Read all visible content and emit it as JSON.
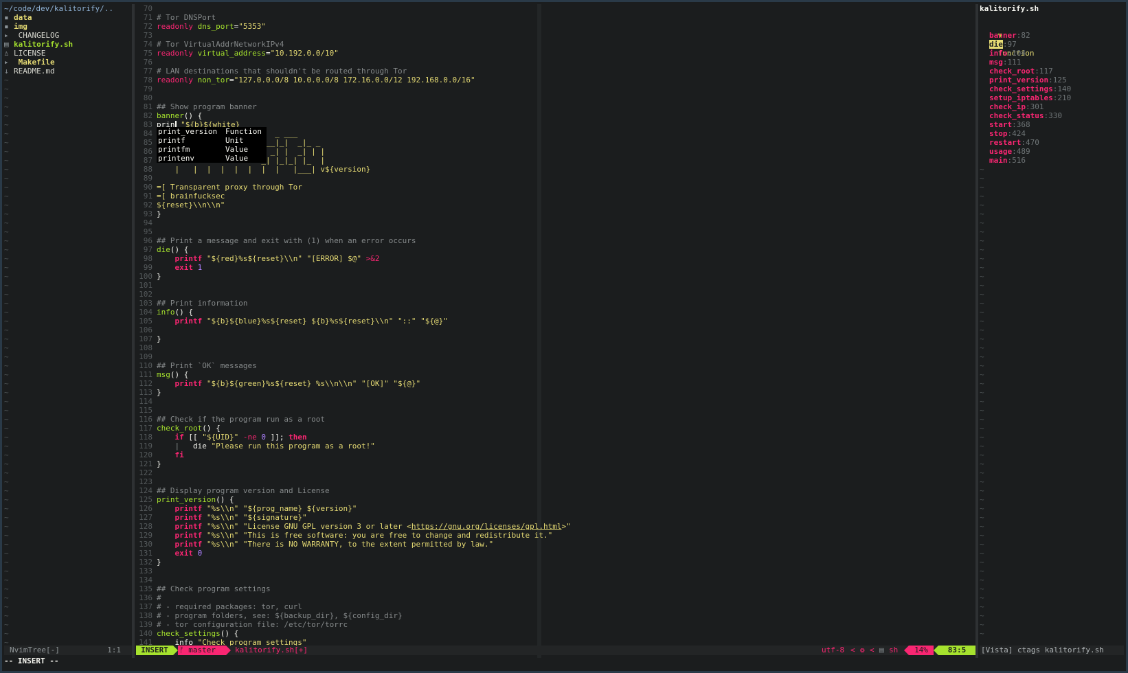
{
  "tree": {
    "root_path": "~/code/dev/kalitorify/..",
    "entries": [
      {
        "icon": "▪",
        "name": "data",
        "kind": "dir"
      },
      {
        "icon": "▪",
        "name": "img",
        "kind": "dir"
      },
      {
        "icon": "▸",
        "name": " CHANGELOG",
        "kind": "file"
      },
      {
        "icon": "▤",
        "name": "kalitorify.sh",
        "kind": "exe"
      },
      {
        "icon": "♙",
        "name": "LICENSE",
        "kind": "file"
      },
      {
        "icon": "▸",
        "name": " Makefile",
        "kind": "dir"
      },
      {
        "icon": "↓",
        "name": "README.md",
        "kind": "file"
      }
    ],
    "empty_marker": "~"
  },
  "editor": {
    "lines": [
      {
        "n": "70",
        "segs": []
      },
      {
        "n": "71",
        "segs": [
          [
            "c",
            "# Tor DNSPort"
          ]
        ]
      },
      {
        "n": "72",
        "segs": [
          [
            "kl",
            "readonly "
          ],
          [
            "f",
            "dns_port"
          ],
          [
            "w",
            "="
          ],
          [
            "s",
            "\"5353\""
          ]
        ]
      },
      {
        "n": "73",
        "segs": []
      },
      {
        "n": "74",
        "segs": [
          [
            "c",
            "# Tor VirtualAddrNetworkIPv4"
          ]
        ]
      },
      {
        "n": "75",
        "segs": [
          [
            "kl",
            "readonly "
          ],
          [
            "f",
            "virtual_address"
          ],
          [
            "w",
            "="
          ],
          [
            "s",
            "\"10.192.0.0/10\""
          ]
        ]
      },
      {
        "n": "76",
        "segs": []
      },
      {
        "n": "77",
        "segs": [
          [
            "c",
            "# LAN destinations that shouldn't be routed through Tor"
          ]
        ]
      },
      {
        "n": "78",
        "segs": [
          [
            "kl",
            "readonly "
          ],
          [
            "f",
            "non_tor"
          ],
          [
            "w",
            "="
          ],
          [
            "s",
            "\"127.0.0.0/8 10.0.0.0/8 172.16.0.0/12 192.168.0.0/16\""
          ]
        ]
      },
      {
        "n": "79",
        "segs": []
      },
      {
        "n": "80",
        "segs": []
      },
      {
        "n": "81",
        "segs": [
          [
            "c",
            "## Show program banner"
          ]
        ]
      },
      {
        "n": "82",
        "segs": [
          [
            "f",
            "banner"
          ],
          [
            "w",
            "() {"
          ]
        ]
      },
      {
        "n": "83",
        "segs": [
          [
            "w",
            "prin"
          ],
          [
            "cursor",
            ""
          ],
          [
            "w",
            " "
          ],
          [
            "s",
            "\"${b}${white}"
          ]
        ]
      },
      {
        "n": "84",
        "segs": [
          [
            "s",
            "                          _ ___"
          ]
        ]
      },
      {
        "n": "85",
        "segs": [
          [
            "s",
            "                       ___|_|  _|_ _"
          ]
        ]
      },
      {
        "n": "86",
        "segs": [
          [
            "s",
            "                         _| |  _| | |"
          ]
        ]
      },
      {
        "n": "87",
        "segs": [
          [
            "s",
            "                       _| |_|_| |_  |"
          ]
        ]
      },
      {
        "n": "88",
        "segs": [
          [
            "s",
            "    |   |  |  |  |  |  |  |   |___| v${version}"
          ]
        ]
      },
      {
        "n": "89",
        "segs": []
      },
      {
        "n": "90",
        "segs": [
          [
            "s",
            "=[ Transparent proxy through Tor"
          ]
        ]
      },
      {
        "n": "91",
        "segs": [
          [
            "s",
            "=[ brainfucksec"
          ]
        ]
      },
      {
        "n": "92",
        "segs": [
          [
            "s",
            "${reset}\\\\n\\\\n\""
          ]
        ]
      },
      {
        "n": "93",
        "segs": [
          [
            "w",
            "}"
          ]
        ]
      },
      {
        "n": "94",
        "segs": []
      },
      {
        "n": "95",
        "segs": []
      },
      {
        "n": "96",
        "segs": [
          [
            "c",
            "## Print a message and exit with (1) when an error occurs"
          ]
        ]
      },
      {
        "n": "97",
        "segs": [
          [
            "f",
            "die"
          ],
          [
            "w",
            "() {"
          ]
        ]
      },
      {
        "n": "98",
        "segs": [
          [
            "w",
            "    "
          ],
          [
            "k",
            "printf"
          ],
          [
            "w",
            " "
          ],
          [
            "s",
            "\"${red}%s${reset}\\\\n\""
          ],
          [
            "w",
            " "
          ],
          [
            "s",
            "\"[ERROR] $@\""
          ],
          [
            "w",
            " "
          ],
          [
            "kl",
            ">&2"
          ]
        ]
      },
      {
        "n": "99",
        "segs": [
          [
            "w",
            "    "
          ],
          [
            "k",
            "exit"
          ],
          [
            "w",
            " "
          ],
          [
            "n",
            "1"
          ]
        ]
      },
      {
        "n": "100",
        "segs": [
          [
            "w",
            "}"
          ]
        ]
      },
      {
        "n": "101",
        "segs": []
      },
      {
        "n": "102",
        "segs": []
      },
      {
        "n": "103",
        "segs": [
          [
            "c",
            "## Print information"
          ]
        ]
      },
      {
        "n": "104",
        "segs": [
          [
            "f",
            "info"
          ],
          [
            "w",
            "() {"
          ]
        ]
      },
      {
        "n": "105",
        "segs": [
          [
            "w",
            "    "
          ],
          [
            "k",
            "printf"
          ],
          [
            "w",
            " "
          ],
          [
            "s",
            "\"${b}${blue}%s${reset} ${b}%s${reset}\\\\n\""
          ],
          [
            "w",
            " "
          ],
          [
            "s",
            "\"::\""
          ],
          [
            "w",
            " "
          ],
          [
            "s",
            "\"${@}\""
          ]
        ]
      },
      {
        "n": "106",
        "segs": []
      },
      {
        "n": "107",
        "segs": [
          [
            "w",
            "}"
          ]
        ]
      },
      {
        "n": "108",
        "segs": []
      },
      {
        "n": "109",
        "segs": []
      },
      {
        "n": "110",
        "segs": [
          [
            "c",
            "## Print `OK` messages"
          ]
        ]
      },
      {
        "n": "111",
        "segs": [
          [
            "f",
            "msg"
          ],
          [
            "w",
            "() {"
          ]
        ]
      },
      {
        "n": "112",
        "segs": [
          [
            "w",
            "    "
          ],
          [
            "k",
            "printf"
          ],
          [
            "w",
            " "
          ],
          [
            "s",
            "\"${b}${green}%s${reset} %s\\\\n\\\\n\""
          ],
          [
            "w",
            " "
          ],
          [
            "s",
            "\"[OK]\""
          ],
          [
            "w",
            " "
          ],
          [
            "s",
            "\"${@}\""
          ]
        ]
      },
      {
        "n": "113",
        "segs": [
          [
            "w",
            "}"
          ]
        ]
      },
      {
        "n": "114",
        "segs": []
      },
      {
        "n": "115",
        "segs": []
      },
      {
        "n": "116",
        "segs": [
          [
            "c",
            "## Check if the program run as a root"
          ]
        ]
      },
      {
        "n": "117",
        "segs": [
          [
            "f",
            "check_root"
          ],
          [
            "w",
            "() {"
          ]
        ]
      },
      {
        "n": "118",
        "segs": [
          [
            "w",
            "    "
          ],
          [
            "k",
            "if"
          ],
          [
            "w",
            " [[ "
          ],
          [
            "s",
            "\"${UID}\""
          ],
          [
            "w",
            " "
          ],
          [
            "kl",
            "-ne"
          ],
          [
            "w",
            " "
          ],
          [
            "n",
            "0"
          ],
          [
            "w",
            " ]]; "
          ],
          [
            "k",
            "then"
          ]
        ]
      },
      {
        "n": "119",
        "segs": [
          [
            "c",
            "    |   "
          ],
          [
            "w",
            "die "
          ],
          [
            "s",
            "\"Please run this program as a root!\""
          ]
        ]
      },
      {
        "n": "120",
        "segs": [
          [
            "w",
            "    "
          ],
          [
            "k",
            "fi"
          ]
        ]
      },
      {
        "n": "121",
        "segs": [
          [
            "w",
            "}"
          ]
        ]
      },
      {
        "n": "122",
        "segs": []
      },
      {
        "n": "123",
        "segs": []
      },
      {
        "n": "124",
        "segs": [
          [
            "c",
            "## Display program version and License"
          ]
        ]
      },
      {
        "n": "125",
        "segs": [
          [
            "f",
            "print_version"
          ],
          [
            "w",
            "() {"
          ]
        ]
      },
      {
        "n": "126",
        "segs": [
          [
            "w",
            "    "
          ],
          [
            "k",
            "printf"
          ],
          [
            "w",
            " "
          ],
          [
            "s",
            "\"%s\\\\n\""
          ],
          [
            "w",
            " "
          ],
          [
            "s",
            "\"${prog_name} ${version}\""
          ]
        ]
      },
      {
        "n": "127",
        "segs": [
          [
            "w",
            "    "
          ],
          [
            "k",
            "printf"
          ],
          [
            "w",
            " "
          ],
          [
            "s",
            "\"%s\\\\n\""
          ],
          [
            "w",
            " "
          ],
          [
            "s",
            "\"${signature}\""
          ]
        ]
      },
      {
        "n": "128",
        "segs": [
          [
            "w",
            "    "
          ],
          [
            "k",
            "printf"
          ],
          [
            "w",
            " "
          ],
          [
            "s",
            "\"%s\\\\n\""
          ],
          [
            "w",
            " "
          ],
          [
            "s",
            "\"License GNU GPL version 3 or later <"
          ],
          [
            "link",
            "https://gnu.org/licenses/gpl.html"
          ],
          [
            "s",
            ">\""
          ]
        ]
      },
      {
        "n": "129",
        "segs": [
          [
            "w",
            "    "
          ],
          [
            "k",
            "printf"
          ],
          [
            "w",
            " "
          ],
          [
            "s",
            "\"%s\\\\n\""
          ],
          [
            "w",
            " "
          ],
          [
            "s",
            "\"This is free software: you are free to change and redistribute it.\""
          ]
        ]
      },
      {
        "n": "130",
        "segs": [
          [
            "w",
            "    "
          ],
          [
            "k",
            "printf"
          ],
          [
            "w",
            " "
          ],
          [
            "s",
            "\"%s\\\\n\""
          ],
          [
            "w",
            " "
          ],
          [
            "s",
            "\"There is NO WARRANTY, to the extent permitted by law.\""
          ]
        ]
      },
      {
        "n": "131",
        "segs": [
          [
            "w",
            "    "
          ],
          [
            "k",
            "exit"
          ],
          [
            "w",
            " "
          ],
          [
            "n",
            "0"
          ]
        ]
      },
      {
        "n": "132",
        "segs": [
          [
            "w",
            "}"
          ]
        ]
      },
      {
        "n": "133",
        "segs": []
      },
      {
        "n": "134",
        "segs": []
      },
      {
        "n": "135",
        "segs": [
          [
            "c",
            "## Check program settings"
          ]
        ]
      },
      {
        "n": "136",
        "segs": [
          [
            "c",
            "#"
          ]
        ]
      },
      {
        "n": "137",
        "segs": [
          [
            "c",
            "# - required packages: tor, curl"
          ]
        ]
      },
      {
        "n": "138",
        "segs": [
          [
            "c",
            "# - program folders, see: ${backup_dir}, ${config_dir}"
          ]
        ]
      },
      {
        "n": "139",
        "segs": [
          [
            "c",
            "# - tor configuration file: /etc/tor/torrc"
          ]
        ]
      },
      {
        "n": "140",
        "segs": [
          [
            "f",
            "check_settings"
          ],
          [
            "w",
            "() {"
          ]
        ]
      },
      {
        "n": "141",
        "segs": [
          [
            "w",
            "    info "
          ],
          [
            "s",
            "\"Check program settings\""
          ]
        ]
      }
    ]
  },
  "completion": {
    "items": [
      {
        "name": "print_version",
        "kind": "Function"
      },
      {
        "name": "printf",
        "kind": "Unit"
      },
      {
        "name": "printfm",
        "kind": "Value"
      },
      {
        "name": "printenv",
        "kind": "Value"
      }
    ]
  },
  "vista": {
    "title": "kalitorify.sh",
    "group_marker": "▼",
    "group_icon": "▯",
    "group_label": "function",
    "tags": [
      {
        "name": "banner",
        "line": "82"
      },
      {
        "name": "die",
        "line": "97",
        "selected": true
      },
      {
        "name": "info",
        "line": "104"
      },
      {
        "name": "msg",
        "line": "111"
      },
      {
        "name": "check_root",
        "line": "117"
      },
      {
        "name": "print_version",
        "line": "125"
      },
      {
        "name": "check_settings",
        "line": "140"
      },
      {
        "name": "setup_iptables",
        "line": "210"
      },
      {
        "name": "check_ip",
        "line": "301"
      },
      {
        "name": "check_status",
        "line": "330"
      },
      {
        "name": "start",
        "line": "368"
      },
      {
        "name": "stop",
        "line": "424"
      },
      {
        "name": "restart",
        "line": "470"
      },
      {
        "name": "usage",
        "line": "489"
      },
      {
        "name": "main",
        "line": "516"
      }
    ]
  },
  "statusline": {
    "tree_label": "NvimTree[-]",
    "tree_pos": "1:1",
    "mode": "INSERT",
    "branch": "ᚠ master",
    "filename": "kalitorify.sh[+]",
    "encoding": "utf-8",
    "os_icon": "❂",
    "ft_icon": "▤",
    "filetype": "sh",
    "percent": "14%",
    "position": "83:5",
    "vista_label": "[Vista] ctags kalitorify.sh"
  },
  "cmdline": "-- INSERT --",
  "colors": {
    "background": "#1b1d1e",
    "keyword": "#f92672",
    "function": "#a6e22e",
    "string": "#e6db74",
    "number": "#ae81ff",
    "comment": "#85898a",
    "mode_bg": "#a6e22e",
    "branch_bg": "#f92672"
  }
}
